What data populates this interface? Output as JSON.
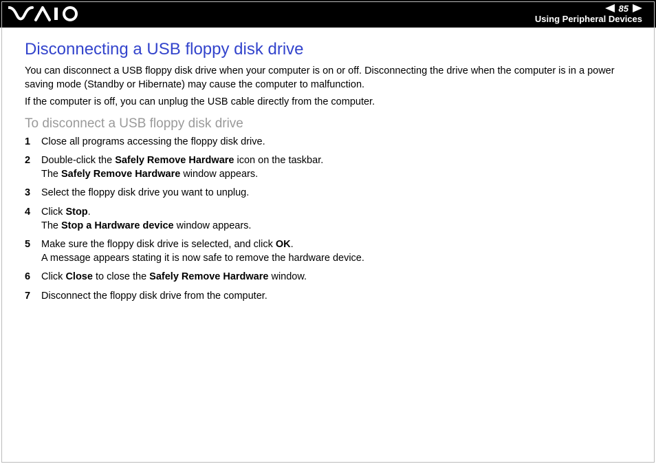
{
  "header": {
    "page_number": "85",
    "section": "Using Peripheral Devices"
  },
  "heading": "Disconnecting a USB floppy disk drive",
  "intro_p1": "You can disconnect a USB floppy disk drive when your computer is on or off. Disconnecting the drive when the computer is in a power saving mode (Standby or Hibernate) may cause the computer to malfunction.",
  "intro_p2": "If the computer is off, you can unplug the USB cable directly from the computer.",
  "subheading": "To disconnect a USB floppy disk drive",
  "steps": [
    {
      "text": "Close all programs accessing the floppy disk drive."
    },
    {
      "pre": "Double-click the ",
      "b1": "Safely Remove Hardware",
      "mid": " icon on the taskbar.",
      "br": true,
      "post_pre": "The ",
      "b2": "Safely Remove Hardware",
      "post": " window appears."
    },
    {
      "text": "Select the floppy disk drive you want to unplug."
    },
    {
      "pre": "Click ",
      "b1": "Stop",
      "mid": ".",
      "br": true,
      "post_pre": "The ",
      "b2": "Stop a Hardware device",
      "post": " window appears."
    },
    {
      "pre": "Make sure the floppy disk drive is selected, and click ",
      "b1": "OK",
      "mid": ".",
      "br": true,
      "post_pre": "A message appears stating it is now safe to remove the hardware device.",
      "b2": "",
      "post": ""
    },
    {
      "pre": "Click ",
      "b1": "Close",
      "mid": " to close the ",
      "b2": "Safely Remove Hardware",
      "post": " window."
    },
    {
      "text": "Disconnect the floppy disk drive from the computer."
    }
  ]
}
